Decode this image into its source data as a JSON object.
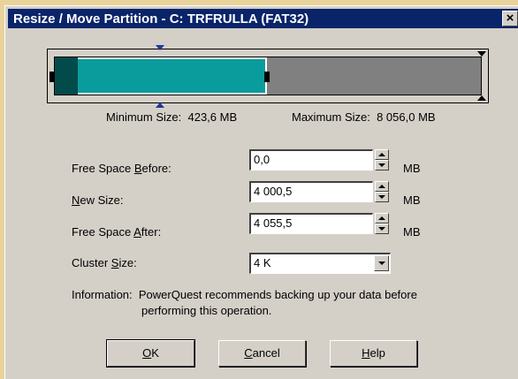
{
  "window": {
    "title": "Resize / Move Partition - C: TRFRULLA (FAT32)",
    "close_glyph": "×"
  },
  "partition_gauge": {
    "minimum_fraction": 0.053,
    "size_fraction": 0.496,
    "colors": {
      "track": "#808080",
      "minimum": "#034b4b",
      "fill": "#0a9c9c"
    }
  },
  "sizes": {
    "minimum_label": "Minimum Size:",
    "minimum_value": "423,6 MB",
    "maximum_label": "Maximum Size:",
    "maximum_value": "8 056,0 MB"
  },
  "fields": {
    "free_before": {
      "label_pre": "Free Space ",
      "label_accel": "B",
      "label_post": "efore:",
      "value": "0,0",
      "unit": "MB"
    },
    "new_size": {
      "label_pre": "",
      "label_accel": "N",
      "label_post": "ew Size:",
      "value": "4 000,5",
      "unit": "MB"
    },
    "free_after": {
      "label_pre": "Free Space ",
      "label_accel": "A",
      "label_post": "fter:",
      "value": "4 055,5",
      "unit": "MB"
    },
    "cluster_size": {
      "label_pre": "Cluster ",
      "label_accel": "S",
      "label_post": "ize:",
      "value": "4 K"
    }
  },
  "information": {
    "label": "Information:",
    "line1": "PowerQuest recommends backing up your data before",
    "line2": "performing this operation."
  },
  "buttons": {
    "ok": {
      "accel": "O",
      "rest": "K"
    },
    "cancel": {
      "accel": "C",
      "rest": "ancel"
    },
    "help": {
      "accel": "H",
      "rest": "elp"
    }
  },
  "icons": {
    "spin_up": "arrow-up-icon",
    "spin_down": "arrow-down-icon",
    "dropdown": "chevron-down-icon",
    "close": "close-icon"
  }
}
